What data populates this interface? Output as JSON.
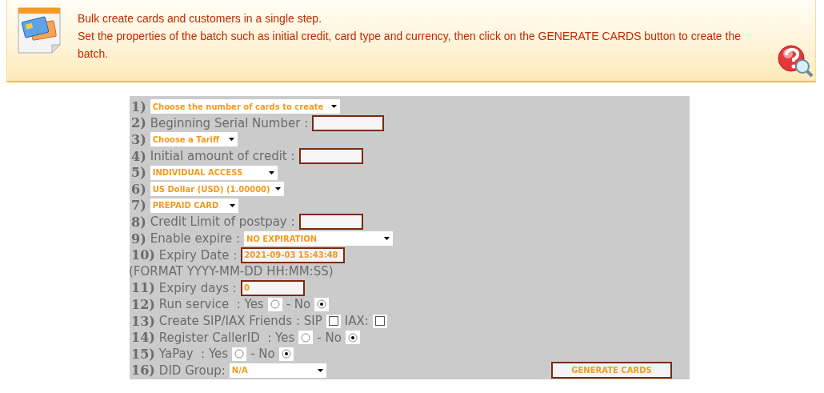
{
  "banner": {
    "lines": [
      "Bulk create cards and customers in a single step.",
      "Set the properties of the batch such as initial credit, card type and currency, then click on the GENERATE CARDS button to create the batch."
    ]
  },
  "form": {
    "rows": [
      {
        "number": "1)",
        "items": [
          {
            "kind": "select",
            "value": "Choose the number of cards to create"
          }
        ]
      },
      {
        "number": "2)",
        "items": [
          {
            "kind": "label",
            "text": "Beginning Serial Number :"
          },
          {
            "kind": "input"
          }
        ]
      },
      {
        "number": "3)",
        "items": [
          {
            "kind": "select",
            "value": "Choose a Tariff"
          }
        ]
      },
      {
        "number": "4)",
        "items": [
          {
            "kind": "label",
            "text": "Initial amount of credit :"
          },
          {
            "kind": "input"
          }
        ]
      },
      {
        "number": "5)",
        "items": [
          {
            "kind": "select",
            "value": "INDIVIDUAL ACCESS"
          }
        ]
      },
      {
        "number": "6)",
        "items": [
          {
            "kind": "select",
            "value": "US Dollar (USD) (1.00000)"
          }
        ]
      },
      {
        "number": "7)",
        "items": [
          {
            "kind": "select",
            "value": "PREPAID CARD"
          }
        ]
      },
      {
        "number": "8)",
        "items": [
          {
            "kind": "label",
            "text": "Credit Limit of postpay :"
          },
          {
            "kind": "input"
          }
        ]
      },
      {
        "number": "9)",
        "items": [
          {
            "kind": "label",
            "text": "Enable expire :"
          },
          {
            "kind": "select",
            "value": "NO EXPIRATION"
          }
        ]
      },
      {
        "number": "10)",
        "items": [
          {
            "kind": "label",
            "text": "Expiry Date :"
          },
          {
            "kind": "input",
            "value": "2021-09-03 15:43:48"
          }
        ]
      },
      {
        "items": [
          {
            "kind": "label",
            "text": "(FORMAT YYYY-MM-DD HH:MM:SS)"
          }
        ]
      },
      {
        "number": "11)",
        "items": [
          {
            "kind": "label",
            "text": "Expiry days :"
          },
          {
            "kind": "input",
            "value": "0"
          }
        ]
      },
      {
        "number": "12)",
        "items": [
          {
            "kind": "label",
            "text": "Run service  : Yes"
          },
          {
            "kind": "radio",
            "selected": false
          },
          {
            "kind": "label",
            "text": "- No"
          },
          {
            "kind": "radio",
            "selected": true
          }
        ]
      },
      {
        "number": "13)",
        "items": [
          {
            "kind": "label",
            "text": "Create SIP/IAX Friends : SIP"
          },
          {
            "kind": "checkbox",
            "checked": false
          },
          {
            "kind": "label",
            "text": "IAX:"
          },
          {
            "kind": "checkbox",
            "checked": false
          }
        ]
      },
      {
        "number": "14)",
        "items": [
          {
            "kind": "label",
            "text": "Register CallerID  : Yes"
          },
          {
            "kind": "radio",
            "selected": false
          },
          {
            "kind": "label",
            "text": "- No"
          },
          {
            "kind": "radio",
            "selected": true
          }
        ]
      },
      {
        "number": "15)",
        "items": [
          {
            "kind": "label",
            "text": "YaPay  : Yes"
          },
          {
            "kind": "radio",
            "selected": false
          },
          {
            "kind": "label",
            "text": "- No"
          },
          {
            "kind": "radio",
            "selected": true
          }
        ]
      },
      {
        "number": "16)",
        "items": [
          {
            "kind": "label",
            "text": "DID Group:"
          },
          {
            "kind": "select",
            "value": "N/A"
          }
        ]
      }
    ],
    "button": "GENERATE CARDS"
  }
}
